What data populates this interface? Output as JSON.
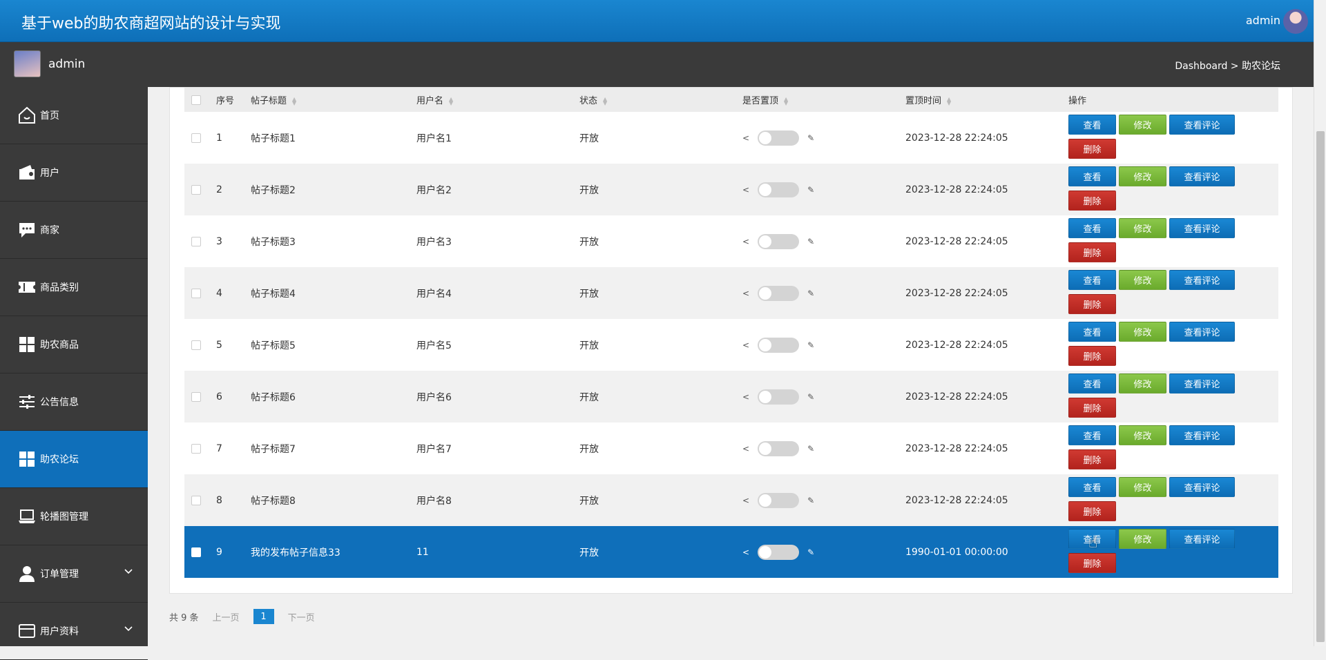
{
  "header": {
    "title": "基于web的助农商超网站的设计与实现",
    "user": "admin"
  },
  "subbar": {
    "name": "admin",
    "breadcrumb": "Dashboard > 助农论坛"
  },
  "sidebar": {
    "items": [
      {
        "label": "首页",
        "icon": "home-icon"
      },
      {
        "label": "用户",
        "icon": "wallet-icon"
      },
      {
        "label": "商家",
        "icon": "chat-icon"
      },
      {
        "label": "商品类别",
        "icon": "ticket-icon"
      },
      {
        "label": "助农商品",
        "icon": "grid-icon"
      },
      {
        "label": "公告信息",
        "icon": "sliders-icon"
      },
      {
        "label": "助农论坛",
        "icon": "grid-icon",
        "active": true
      },
      {
        "label": "轮播图管理",
        "icon": "laptop-icon"
      },
      {
        "label": "订单管理",
        "icon": "user-icon",
        "expandable": true
      },
      {
        "label": "用户资料",
        "icon": "card-icon",
        "expandable": true
      }
    ]
  },
  "table": {
    "headers": {
      "index": "序号",
      "title": "帖子标题",
      "username": "用户名",
      "status": "状态",
      "pinned": "是否置顶",
      "pin_time": "置顶时间",
      "actions": "操作"
    },
    "rows": [
      {
        "index": "1",
        "title": "帖子标题1",
        "username": "用户名1",
        "status": "开放",
        "pin_time": "2023-12-28 22:24:05"
      },
      {
        "index": "2",
        "title": "帖子标题2",
        "username": "用户名2",
        "status": "开放",
        "pin_time": "2023-12-28 22:24:05"
      },
      {
        "index": "3",
        "title": "帖子标题3",
        "username": "用户名3",
        "status": "开放",
        "pin_time": "2023-12-28 22:24:05"
      },
      {
        "index": "4",
        "title": "帖子标题4",
        "username": "用户名4",
        "status": "开放",
        "pin_time": "2023-12-28 22:24:05"
      },
      {
        "index": "5",
        "title": "帖子标题5",
        "username": "用户名5",
        "status": "开放",
        "pin_time": "2023-12-28 22:24:05"
      },
      {
        "index": "6",
        "title": "帖子标题6",
        "username": "用户名6",
        "status": "开放",
        "pin_time": "2023-12-28 22:24:05"
      },
      {
        "index": "7",
        "title": "帖子标题7",
        "username": "用户名7",
        "status": "开放",
        "pin_time": "2023-12-28 22:24:05"
      },
      {
        "index": "8",
        "title": "帖子标题8",
        "username": "用户名8",
        "status": "开放",
        "pin_time": "2023-12-28 22:24:05"
      },
      {
        "index": "9",
        "title": "我的发布帖子信息33",
        "username": "11",
        "status": "开放",
        "pin_time": "1990-01-01 00:00:00",
        "selected": true
      }
    ],
    "actions": {
      "view": "查看",
      "edit": "修改",
      "comments": "查看评论",
      "delete": "删除"
    }
  },
  "pagination": {
    "total": "共 9 条",
    "prev": "上一页",
    "current": "1",
    "next": "下一页"
  },
  "colors": {
    "primary": "#0f6fba",
    "edit": "#7ab83a",
    "delete": "#c0302a",
    "dark": "#3a3a3a"
  }
}
